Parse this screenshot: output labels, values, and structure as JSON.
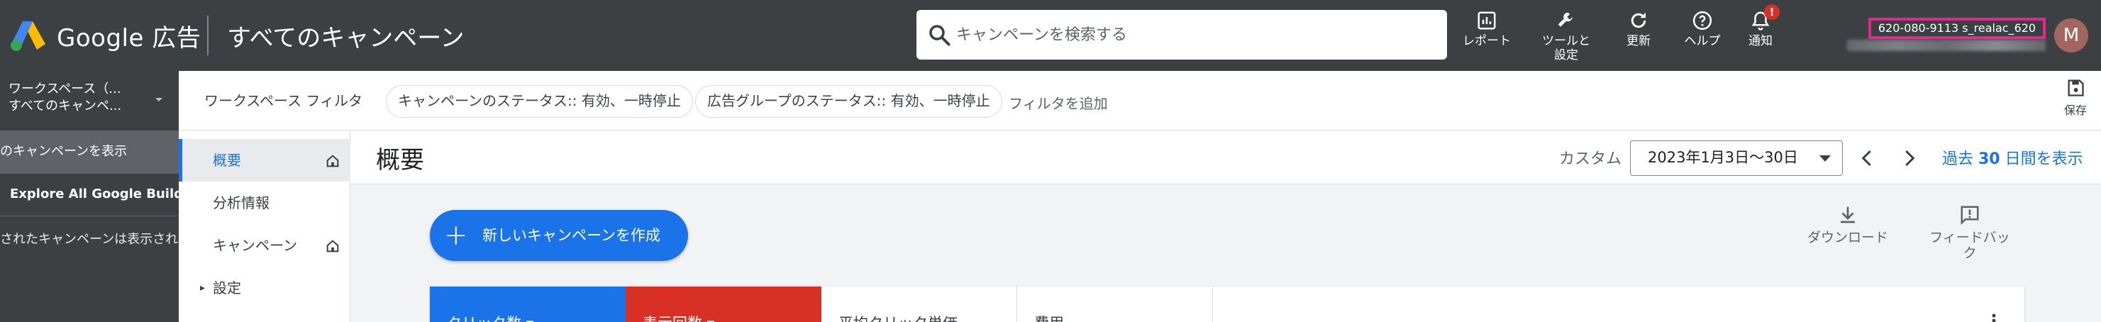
{
  "colors": {
    "topbar": "#3c4043",
    "accent": "#1a73e8",
    "danger": "#d93025",
    "account_highlight": "#e52592",
    "avatar": "#a1665e"
  },
  "header": {
    "brand": "Google 広告",
    "page_title": "すべてのキャンペーン",
    "search_placeholder": "キャンペーンを検索する",
    "tools": {
      "reports": "レポート",
      "tools_line1": "ツールと",
      "tools_line2": "設定",
      "refresh": "更新",
      "help": "ヘルプ",
      "notifications": "通知",
      "notif_badge": "!"
    },
    "account_id": "620-080-9113 s_realac_620",
    "avatar_letter": "M"
  },
  "filterbar": {
    "workspace_line1": "ワークスペース（...",
    "workspace_line2": "すべてのキャンペ...",
    "workspace_filter": "ワークスペース フィルタ",
    "chips": [
      "キャンペーンのステータス:: 有効、一時停止",
      "広告グループのステータス:: 有効、一時停止"
    ],
    "add_filter": "フィルタを追加",
    "save": "保存"
  },
  "leftnav": {
    "items": [
      "のキャンペーンを表示",
      "Explore All Google Builds",
      "されたキャンペーンは表示され"
    ]
  },
  "subnav": {
    "items": [
      {
        "label": "概要"
      },
      {
        "label": "分析情報"
      },
      {
        "label": "キャンペーン"
      },
      {
        "label": "設定"
      }
    ]
  },
  "main": {
    "title": "概要",
    "custom_label": "カスタム",
    "date_range": "2023年1月3日～30日",
    "last30_prefix": "過去 ",
    "last30_num": "30",
    "last30_suffix": " 日間を表示",
    "new_campaign": "新しいキャンペーンを作成",
    "download": "ダウンロード",
    "feedback_line1": "フィードバッ",
    "feedback_line2": "ク",
    "scorecards": [
      "クリック数 ▾",
      "表示回数 ▾",
      "平均クリック単価",
      "費用"
    ]
  }
}
